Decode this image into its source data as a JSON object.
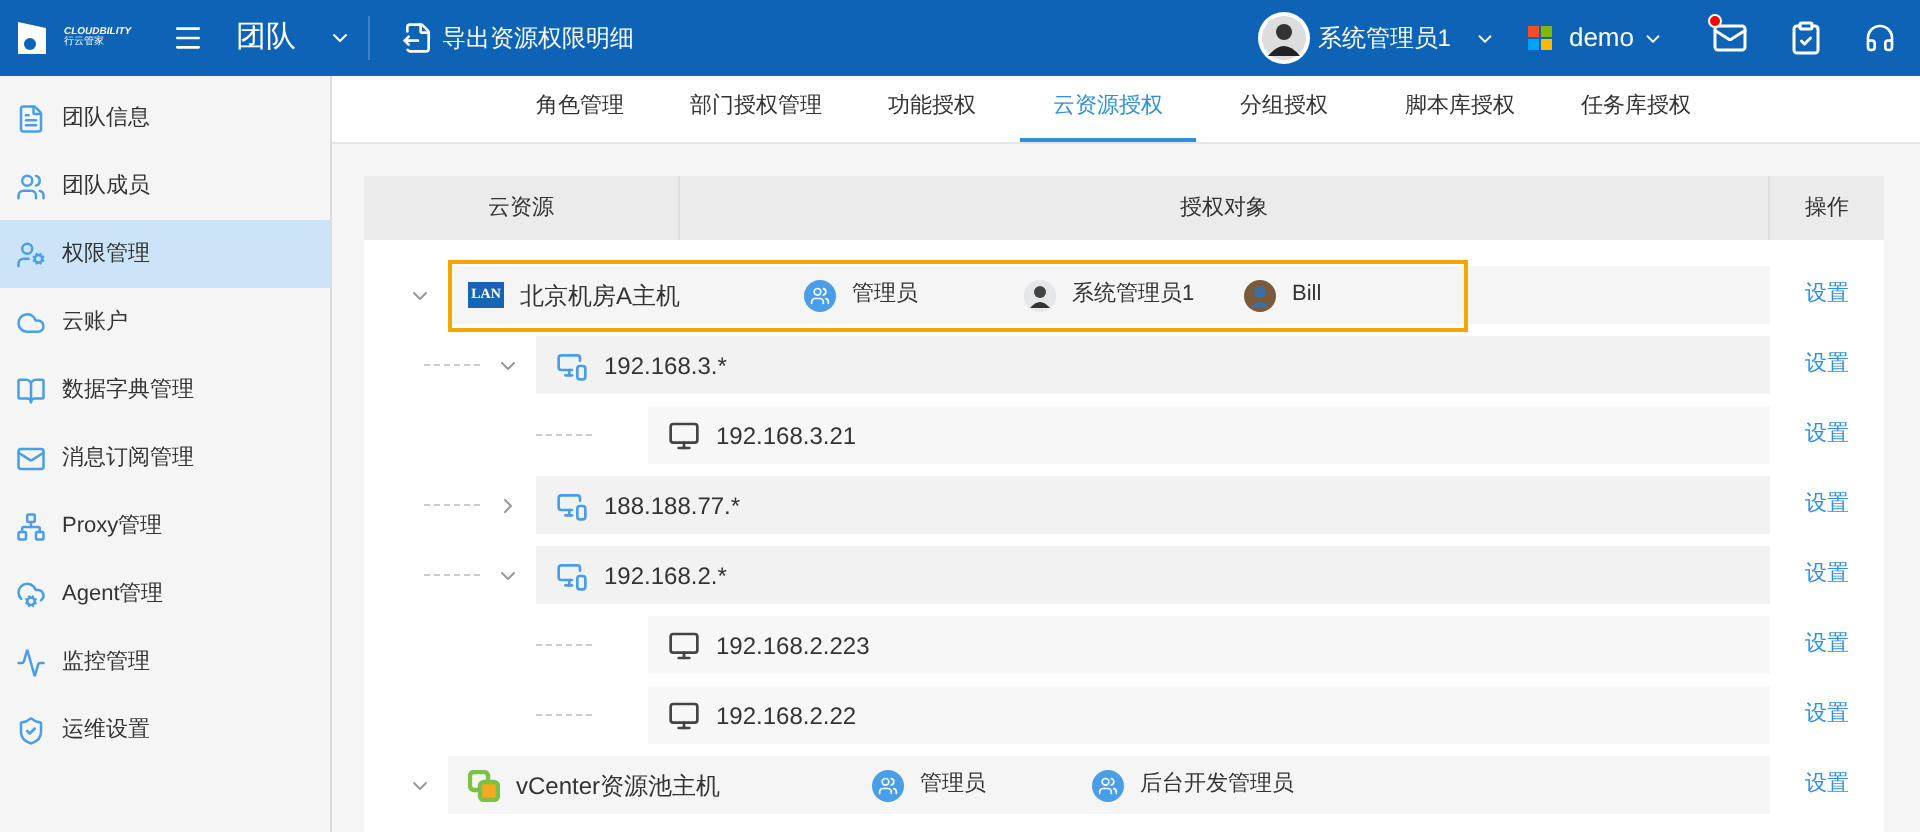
{
  "header": {
    "logo_text": "CLOUDBILITY",
    "logo_subtext": "行云管家",
    "module": "团队",
    "export_link": "导出资源权限明细",
    "user_name": "系统管理员1",
    "tenant": "demo",
    "has_unread_mail": true
  },
  "sidebar": {
    "items": [
      {
        "label": "团队信息",
        "selected": false
      },
      {
        "label": "团队成员",
        "selected": false
      },
      {
        "label": "权限管理",
        "selected": true
      },
      {
        "label": "云账户",
        "selected": false
      },
      {
        "label": "数据字典管理",
        "selected": false
      },
      {
        "label": "消息订阅管理",
        "selected": false
      },
      {
        "label": "Proxy管理",
        "selected": false
      },
      {
        "label": "Agent管理",
        "selected": false
      },
      {
        "label": "监控管理",
        "selected": false
      },
      {
        "label": "运维设置",
        "selected": false
      }
    ]
  },
  "tabs": [
    {
      "label": "角色管理",
      "selected": false
    },
    {
      "label": "部门授权管理",
      "selected": false
    },
    {
      "label": "功能授权",
      "selected": false
    },
    {
      "label": "云资源授权",
      "selected": true
    },
    {
      "label": "分组授权",
      "selected": false
    },
    {
      "label": "脚本库授权",
      "selected": false
    },
    {
      "label": "任务库授权",
      "selected": false
    }
  ],
  "table": {
    "columns": [
      "云资源",
      "授权对象",
      "操作"
    ],
    "rows": [
      {
        "kind": "lan",
        "badge": "LAN",
        "name": "北京机房A主机",
        "expanded": true,
        "highlighted": true,
        "action": "设置",
        "grantees": [
          {
            "kind": "role",
            "name": "管理员"
          },
          {
            "kind": "user",
            "name": "系统管理员1"
          },
          {
            "kind": "user",
            "name": "Bill"
          }
        ],
        "children": [
          {
            "kind": "segment",
            "name": "192.168.3.*",
            "expanded": true,
            "action": "设置",
            "children": [
              {
                "kind": "host",
                "name": "192.168.3.21",
                "action": "设置"
              }
            ]
          },
          {
            "kind": "segment",
            "name": "188.188.77.*",
            "expanded": false,
            "action": "设置"
          },
          {
            "kind": "segment",
            "name": "192.168.2.*",
            "expanded": true,
            "action": "设置",
            "children": [
              {
                "kind": "host",
                "name": "192.168.2.223",
                "action": "设置"
              },
              {
                "kind": "host",
                "name": "192.168.2.22",
                "action": "设置"
              }
            ]
          }
        ]
      },
      {
        "kind": "vcenter",
        "name": "vCenter资源池主机",
        "expanded": true,
        "highlighted": false,
        "action": "设置",
        "grantees": [
          {
            "kind": "role",
            "name": "管理员"
          },
          {
            "kind": "role",
            "name": "后台开发管理员"
          }
        ]
      }
    ]
  }
}
